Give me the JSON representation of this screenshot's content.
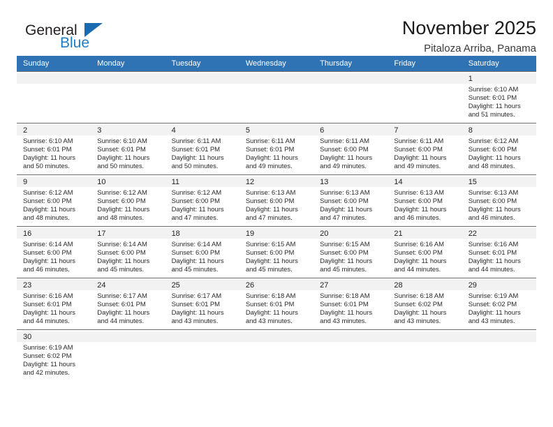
{
  "brand": {
    "name_part1": "General",
    "name_part2": "Blue",
    "logo_icon": "triangle-logo-icon"
  },
  "header": {
    "title": "November 2025",
    "subtitle": "Pitaloza Arriba, Panama"
  },
  "colors": {
    "header_row_bg": "#3073b4",
    "brand_blue": "#1f7dc4",
    "daynum_bg": "#f2f2f2",
    "cell_border": "#6c6c6c"
  },
  "weekday_headers": [
    "Sunday",
    "Monday",
    "Tuesday",
    "Wednesday",
    "Thursday",
    "Friday",
    "Saturday"
  ],
  "weeks": [
    [
      {
        "day": "",
        "lines": []
      },
      {
        "day": "",
        "lines": []
      },
      {
        "day": "",
        "lines": []
      },
      {
        "day": "",
        "lines": []
      },
      {
        "day": "",
        "lines": []
      },
      {
        "day": "",
        "lines": []
      },
      {
        "day": "1",
        "lines": [
          "Sunrise: 6:10 AM",
          "Sunset: 6:01 PM",
          "Daylight: 11 hours",
          "and 51 minutes."
        ]
      }
    ],
    [
      {
        "day": "2",
        "lines": [
          "Sunrise: 6:10 AM",
          "Sunset: 6:01 PM",
          "Daylight: 11 hours",
          "and 50 minutes."
        ]
      },
      {
        "day": "3",
        "lines": [
          "Sunrise: 6:10 AM",
          "Sunset: 6:01 PM",
          "Daylight: 11 hours",
          "and 50 minutes."
        ]
      },
      {
        "day": "4",
        "lines": [
          "Sunrise: 6:11 AM",
          "Sunset: 6:01 PM",
          "Daylight: 11 hours",
          "and 50 minutes."
        ]
      },
      {
        "day": "5",
        "lines": [
          "Sunrise: 6:11 AM",
          "Sunset: 6:01 PM",
          "Daylight: 11 hours",
          "and 49 minutes."
        ]
      },
      {
        "day": "6",
        "lines": [
          "Sunrise: 6:11 AM",
          "Sunset: 6:00 PM",
          "Daylight: 11 hours",
          "and 49 minutes."
        ]
      },
      {
        "day": "7",
        "lines": [
          "Sunrise: 6:11 AM",
          "Sunset: 6:00 PM",
          "Daylight: 11 hours",
          "and 49 minutes."
        ]
      },
      {
        "day": "8",
        "lines": [
          "Sunrise: 6:12 AM",
          "Sunset: 6:00 PM",
          "Daylight: 11 hours",
          "and 48 minutes."
        ]
      }
    ],
    [
      {
        "day": "9",
        "lines": [
          "Sunrise: 6:12 AM",
          "Sunset: 6:00 PM",
          "Daylight: 11 hours",
          "and 48 minutes."
        ]
      },
      {
        "day": "10",
        "lines": [
          "Sunrise: 6:12 AM",
          "Sunset: 6:00 PM",
          "Daylight: 11 hours",
          "and 48 minutes."
        ]
      },
      {
        "day": "11",
        "lines": [
          "Sunrise: 6:12 AM",
          "Sunset: 6:00 PM",
          "Daylight: 11 hours",
          "and 47 minutes."
        ]
      },
      {
        "day": "12",
        "lines": [
          "Sunrise: 6:13 AM",
          "Sunset: 6:00 PM",
          "Daylight: 11 hours",
          "and 47 minutes."
        ]
      },
      {
        "day": "13",
        "lines": [
          "Sunrise: 6:13 AM",
          "Sunset: 6:00 PM",
          "Daylight: 11 hours",
          "and 47 minutes."
        ]
      },
      {
        "day": "14",
        "lines": [
          "Sunrise: 6:13 AM",
          "Sunset: 6:00 PM",
          "Daylight: 11 hours",
          "and 46 minutes."
        ]
      },
      {
        "day": "15",
        "lines": [
          "Sunrise: 6:13 AM",
          "Sunset: 6:00 PM",
          "Daylight: 11 hours",
          "and 46 minutes."
        ]
      }
    ],
    [
      {
        "day": "16",
        "lines": [
          "Sunrise: 6:14 AM",
          "Sunset: 6:00 PM",
          "Daylight: 11 hours",
          "and 46 minutes."
        ]
      },
      {
        "day": "17",
        "lines": [
          "Sunrise: 6:14 AM",
          "Sunset: 6:00 PM",
          "Daylight: 11 hours",
          "and 45 minutes."
        ]
      },
      {
        "day": "18",
        "lines": [
          "Sunrise: 6:14 AM",
          "Sunset: 6:00 PM",
          "Daylight: 11 hours",
          "and 45 minutes."
        ]
      },
      {
        "day": "19",
        "lines": [
          "Sunrise: 6:15 AM",
          "Sunset: 6:00 PM",
          "Daylight: 11 hours",
          "and 45 minutes."
        ]
      },
      {
        "day": "20",
        "lines": [
          "Sunrise: 6:15 AM",
          "Sunset: 6:00 PM",
          "Daylight: 11 hours",
          "and 45 minutes."
        ]
      },
      {
        "day": "21",
        "lines": [
          "Sunrise: 6:16 AM",
          "Sunset: 6:00 PM",
          "Daylight: 11 hours",
          "and 44 minutes."
        ]
      },
      {
        "day": "22",
        "lines": [
          "Sunrise: 6:16 AM",
          "Sunset: 6:01 PM",
          "Daylight: 11 hours",
          "and 44 minutes."
        ]
      }
    ],
    [
      {
        "day": "23",
        "lines": [
          "Sunrise: 6:16 AM",
          "Sunset: 6:01 PM",
          "Daylight: 11 hours",
          "and 44 minutes."
        ]
      },
      {
        "day": "24",
        "lines": [
          "Sunrise: 6:17 AM",
          "Sunset: 6:01 PM",
          "Daylight: 11 hours",
          "and 44 minutes."
        ]
      },
      {
        "day": "25",
        "lines": [
          "Sunrise: 6:17 AM",
          "Sunset: 6:01 PM",
          "Daylight: 11 hours",
          "and 43 minutes."
        ]
      },
      {
        "day": "26",
        "lines": [
          "Sunrise: 6:18 AM",
          "Sunset: 6:01 PM",
          "Daylight: 11 hours",
          "and 43 minutes."
        ]
      },
      {
        "day": "27",
        "lines": [
          "Sunrise: 6:18 AM",
          "Sunset: 6:01 PM",
          "Daylight: 11 hours",
          "and 43 minutes."
        ]
      },
      {
        "day": "28",
        "lines": [
          "Sunrise: 6:18 AM",
          "Sunset: 6:02 PM",
          "Daylight: 11 hours",
          "and 43 minutes."
        ]
      },
      {
        "day": "29",
        "lines": [
          "Sunrise: 6:19 AM",
          "Sunset: 6:02 PM",
          "Daylight: 11 hours",
          "and 43 minutes."
        ]
      }
    ],
    [
      {
        "day": "30",
        "lines": [
          "Sunrise: 6:19 AM",
          "Sunset: 6:02 PM",
          "Daylight: 11 hours",
          "and 42 minutes."
        ]
      },
      {
        "day": "",
        "lines": []
      },
      {
        "day": "",
        "lines": []
      },
      {
        "day": "",
        "lines": []
      },
      {
        "day": "",
        "lines": []
      },
      {
        "day": "",
        "lines": []
      },
      {
        "day": "",
        "lines": []
      }
    ]
  ]
}
